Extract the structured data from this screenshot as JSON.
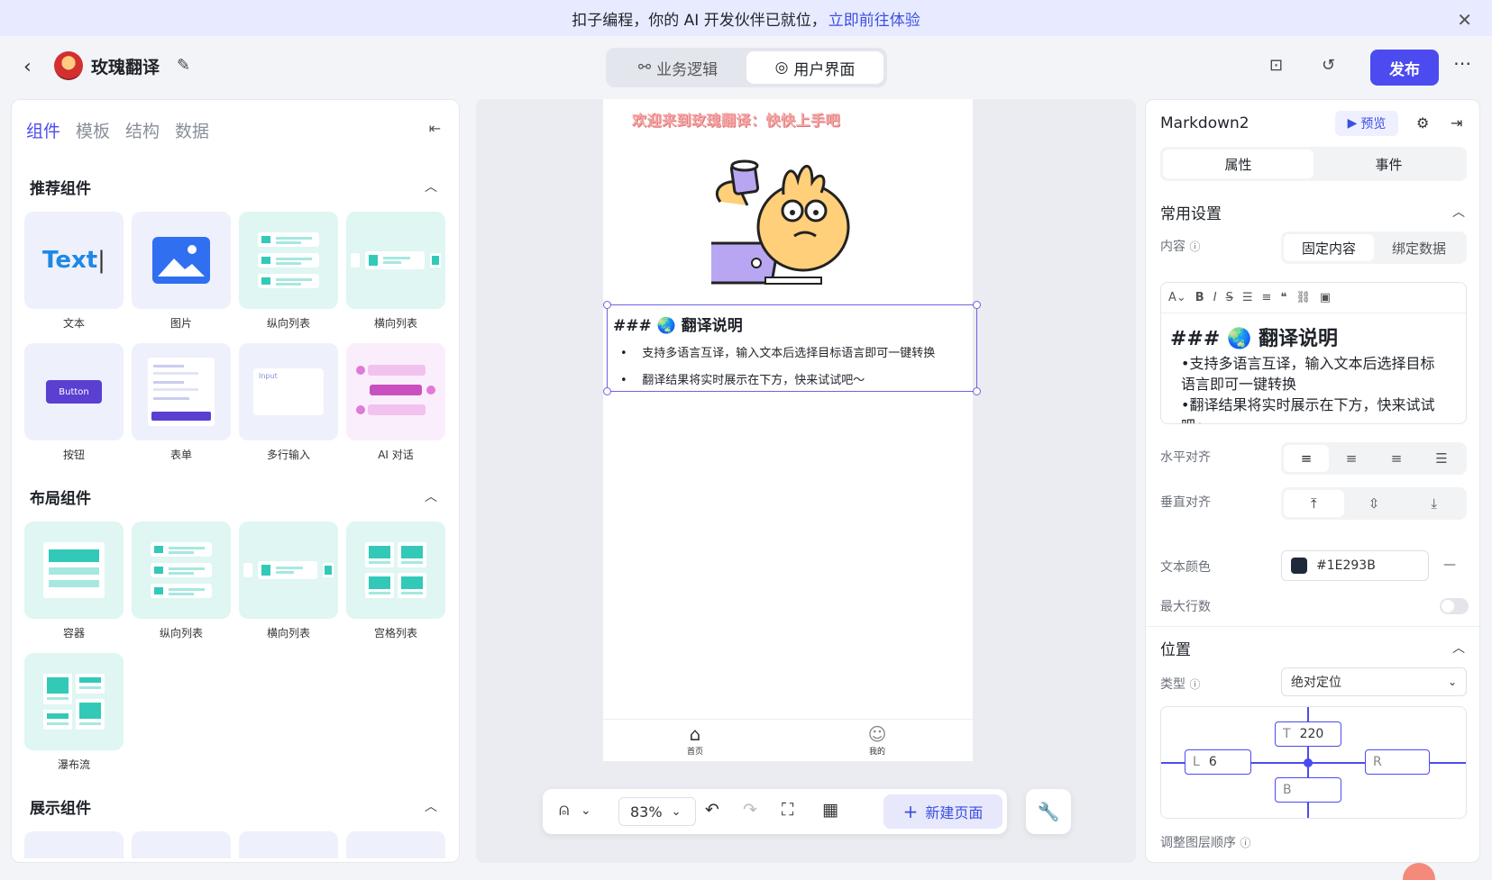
{
  "banner": {
    "text": "扣子编程，你的 AI 开发伙伴已就位，",
    "link": "立即前往体验",
    "close_icon": "close-icon"
  },
  "header": {
    "app_name": "玫瑰翻译",
    "mode_tabs": [
      {
        "label": "业务逻辑",
        "icon": "flow-icon",
        "active": false
      },
      {
        "label": "用户界面",
        "icon": "palette-icon",
        "active": true
      }
    ],
    "publish_label": "发布"
  },
  "left_panel": {
    "tabs": [
      "组件",
      "模板",
      "结构",
      "数据"
    ],
    "sections": {
      "recommended": "推荐组件",
      "layout": "布局组件",
      "display": "展示组件"
    },
    "recommended_items": [
      "文本",
      "图片",
      "纵向列表",
      "横向列表",
      "按钮",
      "表单",
      "多行输入",
      "AI 对话"
    ],
    "layout_items": [
      "容器",
      "纵向列表",
      "横向列表",
      "宫格列表",
      "瀑布流"
    ],
    "thumb_text": "Text",
    "thumb_button": "Button",
    "thumb_input": "Input"
  },
  "canvas": {
    "page_title": "欢迎来到玫瑰翻译：快快上手吧",
    "md_heading": "### 🌏 翻译说明",
    "md_items": [
      "支持多语言互译，输入文本后选择目标语言即可一键转换",
      "翻译结果将实时展示在下方，快来试试吧〜"
    ],
    "tab_home": "首页",
    "tab_mine": "我的",
    "zoom": "83%",
    "new_page_label": "新建页面"
  },
  "right_panel": {
    "component_name": "Markdown2",
    "preview_label": "预览",
    "seg_tabs": [
      "属性",
      "事件"
    ],
    "common_settings": "常用设置",
    "content_label": "内容",
    "content_modes": [
      "固定内容",
      "绑定数据"
    ],
    "editor_heading": "### 🌏 翻译说明",
    "editor_lines": [
      "•支持多语言互译，输入文本后选择目标语言即可一键转换",
      "•翻译结果将实时展示在下方，快来试试吧〜"
    ],
    "h_align_label": "水平对齐",
    "v_align_label": "垂直对齐",
    "text_color_label": "文本颜色",
    "text_color_value": "#1E293B",
    "max_lines_label": "最大行数",
    "position_section": "位置",
    "type_label": "类型",
    "type_value": "绝对定位",
    "pos_t": "220",
    "pos_l": "6",
    "pos_r": "",
    "pos_b": "",
    "layer_order_label": "调整图层顺序"
  },
  "colors": {
    "accent": "#4B4BF0",
    "text_color": "#1E293B"
  }
}
